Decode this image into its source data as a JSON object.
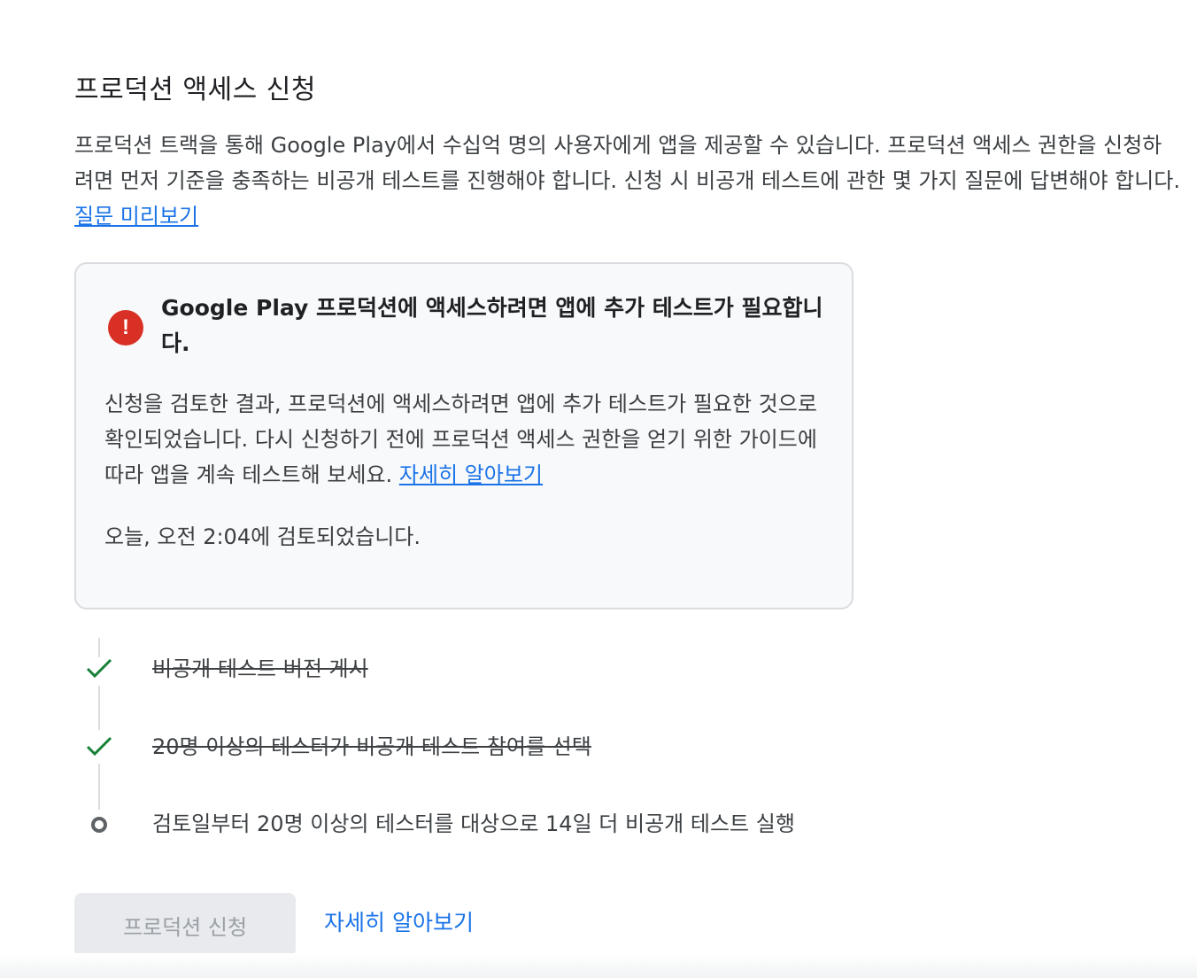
{
  "title": "프로덕션 액세스 신청",
  "intro": {
    "text": "프로덕션 트랙을 통해 Google Play에서 수십억 명의 사용자에게 앱을 제공할 수 있습니다. 프로덕션 액세스 권한을 신청하려면 먼저 기준을 충족하는 비공개 테스트를 진행해야 합니다. 신청 시 비공개 테스트에 관한 몇 가지 질문에 답변해야 합니다. ",
    "link_label": "질문 미리보기"
  },
  "alert": {
    "icon": "error-icon",
    "icon_glyph": "!",
    "icon_color": "#d93025",
    "title": "Google Play 프로덕션에 액세스하려면 앱에 추가 테스트가 필요합니다.",
    "body": "신청을 검토한 결과, 프로덕션에 액세스하려면 앱에 추가 테스트가 필요한 것으로 확인되었습니다. 다시 신청하기 전에 프로덕션 액세스 권한을 얻기 위한 가이드에 따라 앱을 계속 테스트해 보세요. ",
    "link_label": "자세히 알아보기",
    "reviewed": "오늘, 오전 2:04에 검토되었습니다."
  },
  "steps": [
    {
      "label": "비공개 테스트 버전 게시",
      "status": "done",
      "icon": "check-icon"
    },
    {
      "label": "20명 이상의 테스터가 비공개 테스트 참여를 선택",
      "status": "done",
      "icon": "check-icon"
    },
    {
      "label": "검토일부터 20명 이상의 테스터를 대상으로 14일 더 비공개 테스트 실행",
      "status": "pending",
      "icon": "circle-icon"
    }
  ],
  "actions": {
    "apply_label": "프로덕션 신청",
    "apply_disabled": true,
    "learn_more_label": "자세히 알아보기"
  },
  "colors": {
    "link": "#1a73e8",
    "check": "#188038",
    "error": "#d93025"
  }
}
